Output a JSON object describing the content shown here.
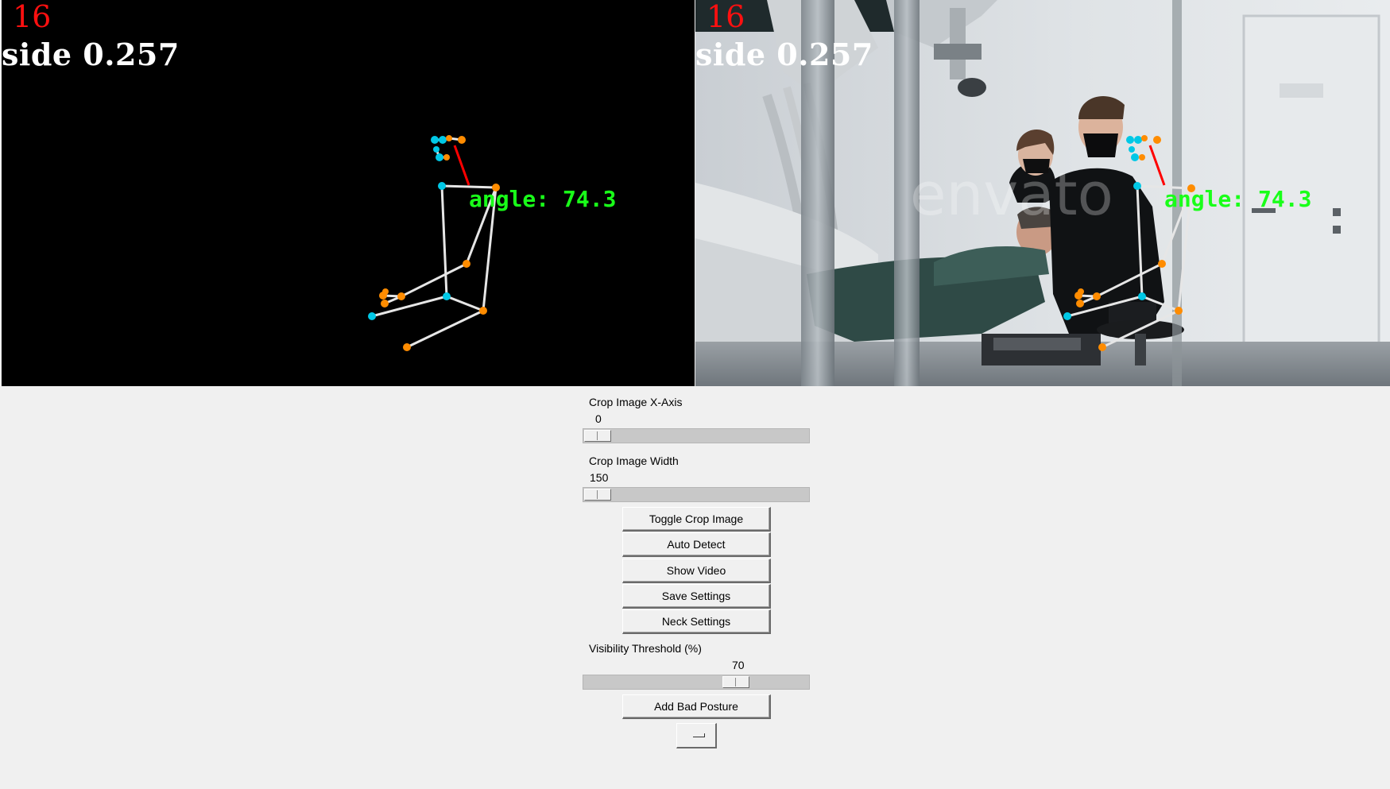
{
  "overlay": {
    "frame_number": "16",
    "side_text": "side 0.257",
    "angle_text": "angle: 74.3",
    "colors": {
      "frame_number": "#ff1010",
      "side_text": "#ffffff",
      "angle_text": "#19ff19",
      "neck_line": "#ff0000",
      "skeleton": "#e6e6e6",
      "joint_left": "#00c8e6",
      "joint_right": "#ff8c00"
    }
  },
  "video": {
    "left_view": "black background with pose skeleton",
    "right_view": "dental clinic video frame with pose skeleton overlay",
    "watermark": "envato"
  },
  "controls": {
    "crop_x": {
      "label": "Crop Image X-Axis",
      "value": "0",
      "fraction": 0.0
    },
    "crop_width": {
      "label": "Crop Image Width",
      "value": "150",
      "fraction": 0.0
    },
    "buttons": {
      "toggle_crop": "Toggle Crop Image",
      "auto_detect": "Auto Detect",
      "show_video": "Show Video",
      "save_settings": "Save Settings",
      "neck_settings": "Neck Settings"
    },
    "visibility": {
      "label": "Visibility Threshold (%)",
      "value": "70",
      "fraction": 0.7
    },
    "add_bad_posture": "Add Bad Posture",
    "small_button_icon": "return-icon"
  }
}
